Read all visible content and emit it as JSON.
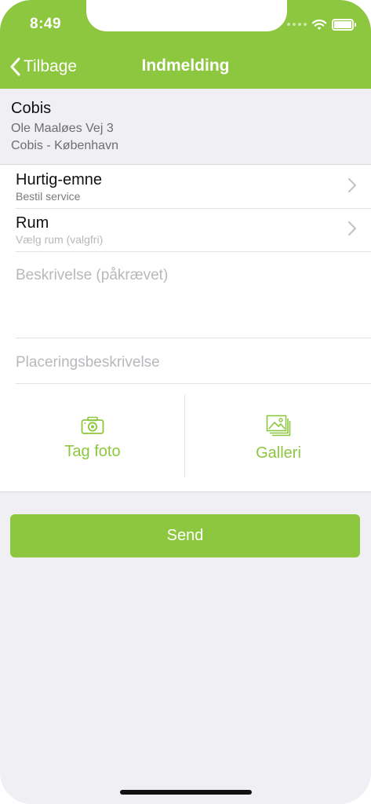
{
  "status": {
    "time": "8:49"
  },
  "nav": {
    "back_label": "Tilbage",
    "title": "Indmelding"
  },
  "site": {
    "name": "Cobis",
    "address": "Ole Maaløes Vej 3",
    "location": "Cobis - København"
  },
  "rows": [
    {
      "title": "Hurtig-emne",
      "subtitle": "Bestil service"
    },
    {
      "title": "Rum",
      "subtitle": "Vælg rum (valgfri)"
    }
  ],
  "fields": {
    "description_placeholder": "Beskrivelse (påkrævet)",
    "placement_placeholder": "Placeringsbeskrivelse"
  },
  "media": {
    "camera_label": "Tag foto",
    "gallery_label": "Galleri"
  },
  "actions": {
    "send_label": "Send"
  },
  "colors": {
    "accent": "#8dc63f",
    "background": "#efeff4"
  }
}
